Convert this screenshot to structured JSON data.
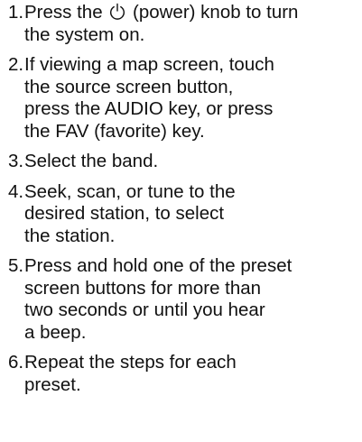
{
  "steps": [
    {
      "number": "1.",
      "line1_before": "Press the ",
      "power_icon": "power-icon",
      "line1_after": " (power) knob to turn",
      "lines": [
        "the system on."
      ]
    },
    {
      "number": "2.",
      "lines": [
        "If viewing a map screen, touch",
        "the source screen button,",
        "press the AUDIO key, or press",
        "the FAV (favorite) key."
      ]
    },
    {
      "number": "3.",
      "lines": [
        "Select the band."
      ]
    },
    {
      "number": "4.",
      "lines": [
        "Seek, scan, or tune to the",
        "desired station, to select",
        "the station."
      ]
    },
    {
      "number": "5.",
      "lines": [
        "Press and hold one of the preset",
        "screen buttons for more than",
        "two seconds or until you hear",
        "a beep."
      ]
    },
    {
      "number": "6.",
      "lines": [
        "Repeat the steps for each",
        "preset."
      ]
    }
  ]
}
